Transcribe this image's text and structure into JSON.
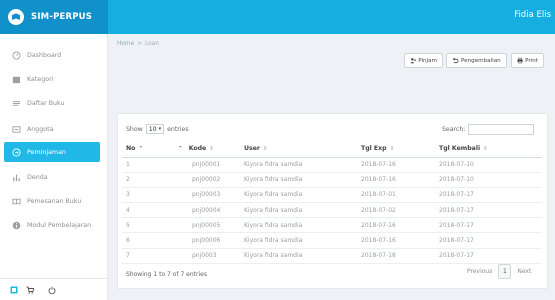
{
  "header": {
    "brand": "SIM-PERPUS",
    "user": "Fidia Elis",
    "colors": {
      "bar": "#14aee0",
      "brand_bg": "#1191c9"
    }
  },
  "sidebar": {
    "items": [
      {
        "label": "Dashboard",
        "icon": "dashboard-icon"
      },
      {
        "label": "Kategori",
        "icon": "folder-icon"
      },
      {
        "label": "Daftar Buku",
        "icon": "list-icon"
      },
      {
        "label": "Anggota",
        "icon": "id-card-icon"
      },
      {
        "label": "Peminjaman",
        "icon": "circle-arrow-icon",
        "active": true
      },
      {
        "label": "Denda",
        "icon": "bar-chart-icon"
      },
      {
        "label": "Pemesanan Buku",
        "icon": "book-icon"
      },
      {
        "label": "Modul Pembelajaran",
        "icon": "info-icon"
      }
    ],
    "footer_icons": [
      "window-icon",
      "cart-icon",
      "power-icon"
    ],
    "active_color": "#20b8e6"
  },
  "breadcrumb": {
    "home": "Home",
    "sep": ">",
    "current": "Loan"
  },
  "toolbar": {
    "pinjam": "Pinjam",
    "pengembalian": "Pengembalian",
    "print": "Print"
  },
  "table_controls": {
    "show_label": "Show",
    "show_value": "10",
    "entries_label": "entries",
    "search_label": "Search:"
  },
  "table": {
    "headers": [
      "No",
      "Kode",
      "User",
      "Tgl Exp",
      "Tgl Kembali"
    ],
    "rows": [
      [
        "1",
        "pnj00001",
        "Kiyora fidra samdia",
        "2018-07-16",
        "2018-07-10"
      ],
      [
        "2",
        "pnj00002",
        "Kiyora fidra samdia",
        "2018-07-16",
        "2018-07-10"
      ],
      [
        "3",
        "pnj00003",
        "Kiyora fidra samdia",
        "2018-07-01",
        "2018-07-17"
      ],
      [
        "4",
        "pnj00004",
        "Kiyora fidra samdia",
        "2018-07-02",
        "2018-07-17"
      ],
      [
        "5",
        "pnj00005",
        "Kiyora fidra samdia",
        "2018-07-16",
        "2018-07-17"
      ],
      [
        "6",
        "pnj00006",
        "Kiyora fidra samdia",
        "2018-07-16",
        "2018-07-17"
      ],
      [
        "7",
        "pnj0003",
        "Kiyora fidra samdia",
        "2018-07-18",
        "2018-07-17"
      ]
    ]
  },
  "footer": {
    "info": "Showing 1 to 7 of 7 entries",
    "previous": "Previous",
    "page": "1",
    "next": "Next"
  }
}
